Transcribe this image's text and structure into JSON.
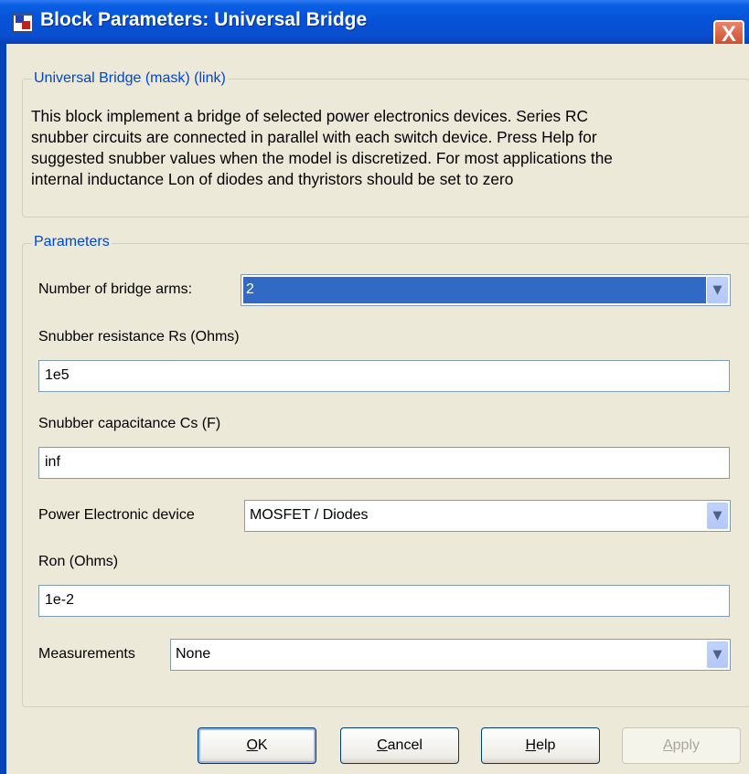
{
  "window": {
    "title": "Block Parameters: Universal Bridge",
    "close_glyph": "X"
  },
  "description_group": {
    "label": "Universal Bridge (mask) (link)",
    "lines": [
      "This block implement a bridge of selected power electronics devices.  Series RC",
      "snubber circuits are connected in parallel with each switch device.  Press Help for",
      "suggested snubber values when the model is discretized. For most applications the",
      "internal inductance Lon of diodes and thyristors should be set to zero"
    ]
  },
  "parameters_group": {
    "label": "Parameters",
    "bridge_arms": {
      "label": "Number of bridge arms:",
      "value": "2"
    },
    "snubber_resistance": {
      "label": "Snubber resistance Rs (Ohms)",
      "value": "1e5"
    },
    "snubber_capacitance": {
      "label": "Snubber capacitance Cs (F)",
      "value": "inf"
    },
    "device": {
      "label": "Power Electronic device",
      "value": "MOSFET / Diodes"
    },
    "ron": {
      "label": "Ron (Ohms)",
      "value": "1e-2"
    },
    "measurements": {
      "label": "Measurements",
      "value": "None"
    }
  },
  "buttons": {
    "ok": {
      "first": "O",
      "rest": "K"
    },
    "cancel": {
      "first": "C",
      "rest": "ancel"
    },
    "help": {
      "first": "H",
      "rest": "elp"
    },
    "apply": {
      "first": "A",
      "rest": "pply",
      "enabled": false
    }
  },
  "icons": {
    "dropdown": "chevron-down-icon",
    "app": "simulink-block-icon"
  }
}
